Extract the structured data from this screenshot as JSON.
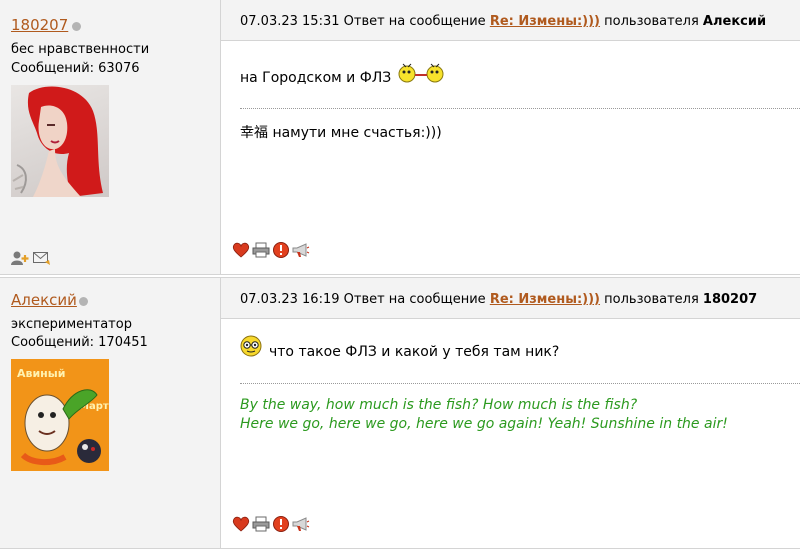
{
  "posts": [
    {
      "author": "180207",
      "rank": "бес нравственности",
      "messages_label": "Сообщений: 63076",
      "timestamp": "07.03.23 15:31",
      "reply_prefix": "Ответ на сообщение",
      "reply_link": "Re: Измены:)))",
      "reply_user_prefix": "пользователя",
      "reply_user": "Алексий",
      "body": "на Городском и ФЛЗ",
      "signature": "幸福 намути мне счастья:)))"
    },
    {
      "author": "Алексий",
      "rank": "экспериментатор",
      "messages_label": "Сообщений: 170451",
      "timestamp": "07.03.23 16:19",
      "reply_prefix": "Ответ на сообщение",
      "reply_link": "Re: Измены:)))",
      "reply_user_prefix": "пользователя",
      "reply_user": "180207",
      "body": "что такое ФЛЗ и какой у тебя там ник?",
      "signature_lines": [
        "By the way, how much is the fish? How much is the fish?",
        "Here we go, here we go, here we go again! Yeah! Sunshine in the air!"
      ]
    }
  ],
  "colors": {
    "link": "#b05a1e",
    "signature": "#2c9a1f",
    "panel": "#f3f3f3"
  },
  "icons": [
    "status-offline-icon",
    "add-friend-icon",
    "send-message-icon",
    "like-heart-icon",
    "print-icon",
    "report-icon",
    "megaphone-icon"
  ]
}
